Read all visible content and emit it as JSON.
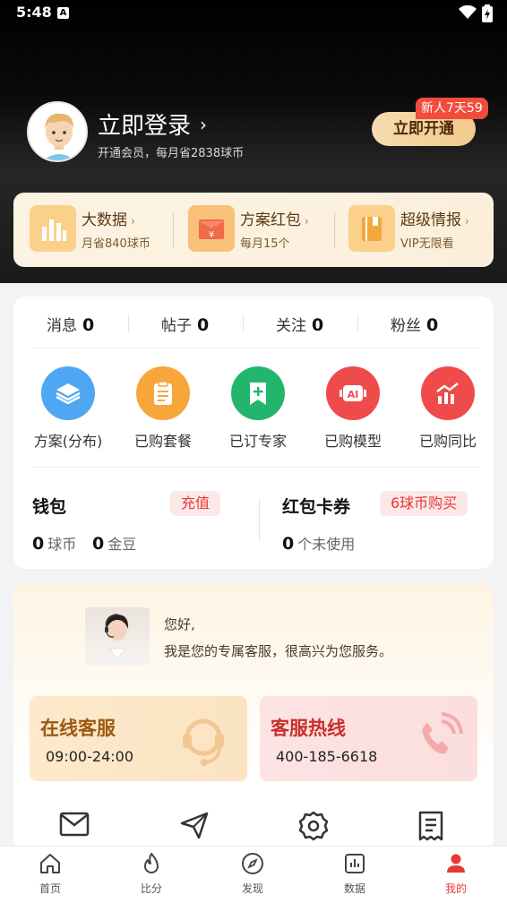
{
  "status_bar": {
    "time": "5:48",
    "app_icon": "A"
  },
  "header": {
    "login_title": "立即登录",
    "login_subtitle": "开通会员，每月省2838球币",
    "open_button": "立即开通",
    "new_badge": "新人7天59"
  },
  "vip_benefits": [
    {
      "title": "大数据",
      "subtitle": "月省840球币",
      "icon": "bar-chart-icon"
    },
    {
      "title": "方案红包",
      "subtitle": "每月15个",
      "icon": "red-envelope-icon"
    },
    {
      "title": "超级情报",
      "subtitle": "VIP无限看",
      "icon": "notebook-icon"
    }
  ],
  "stats": [
    {
      "label": "消息",
      "value": "0"
    },
    {
      "label": "帖子",
      "value": "0"
    },
    {
      "label": "关注",
      "value": "0"
    },
    {
      "label": "粉丝",
      "value": "0"
    }
  ],
  "features": [
    {
      "label": "方案(分布)",
      "icon": "layers-icon",
      "color": "#4fa6f2"
    },
    {
      "label": "已购套餐",
      "icon": "clipboard-icon",
      "color": "#f7a63b"
    },
    {
      "label": "已订专家",
      "icon": "bookmark-plus-icon",
      "color": "#22b56b"
    },
    {
      "label": "已购模型",
      "icon": "ai-chip-icon",
      "color": "#ef4b4b"
    },
    {
      "label": "已购同比",
      "icon": "trend-chart-icon",
      "color": "#ef4b4b"
    }
  ],
  "wallet": {
    "title": "钱包",
    "recharge": "充值",
    "coins_value": "0",
    "coins_label": "球币",
    "beans_value": "0",
    "beans_label": "金豆"
  },
  "coupons": {
    "title": "红包卡券",
    "buy": "6球币购买",
    "count": "0",
    "count_label": "个未使用"
  },
  "service": {
    "greeting1": "您好,",
    "greeting2": "我是您的专属客服，很高兴为您服务。",
    "online_title": "在线客服",
    "online_hours": "09:00-24:00",
    "hotline_title": "客服热线",
    "hotline_number": "400-185-6618"
  },
  "tools": [
    "mail-icon",
    "send-icon",
    "settings-icon",
    "receipt-icon"
  ],
  "bottom_nav": [
    {
      "label": "首页",
      "icon": "home-icon"
    },
    {
      "label": "比分",
      "icon": "flame-icon"
    },
    {
      "label": "发现",
      "icon": "compass-icon"
    },
    {
      "label": "数据",
      "icon": "chart-icon"
    },
    {
      "label": "我的",
      "icon": "user-icon",
      "active": true
    }
  ],
  "colors": {
    "accent": "#e53935",
    "gold": "#f3c98d",
    "dark": "#0b0b0b"
  }
}
